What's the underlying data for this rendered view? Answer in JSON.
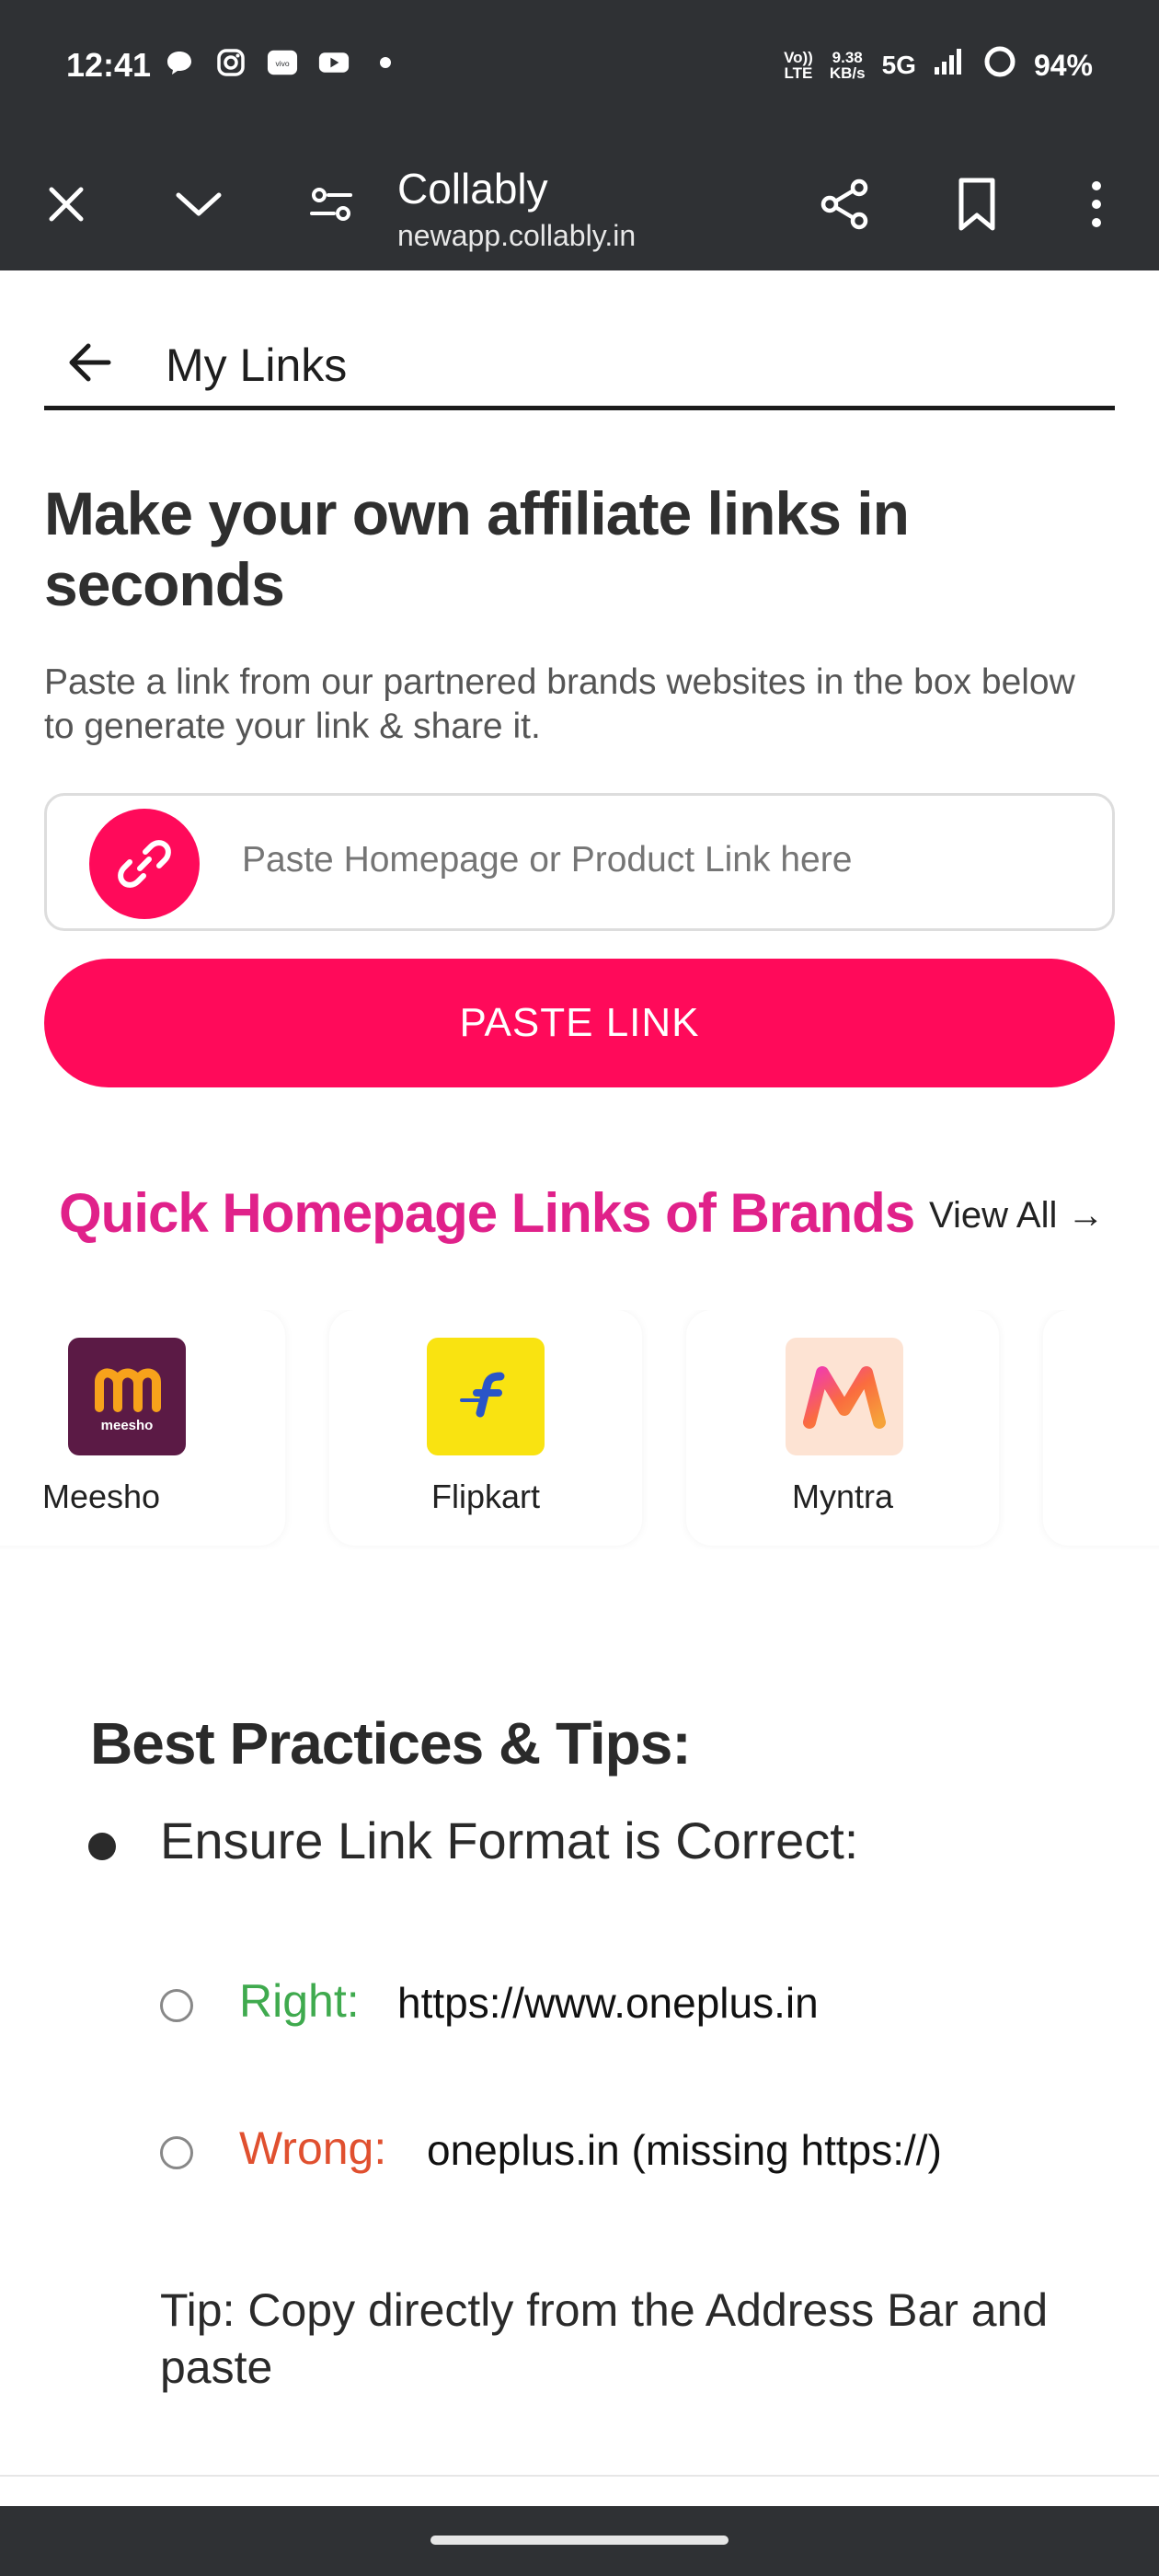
{
  "status_bar": {
    "time": "12:41",
    "network_speed_top": "9.38",
    "network_speed_unit": "KB/s",
    "volte_top": "Vo))",
    "volte_bottom": "LTE",
    "network": "5G",
    "battery": "94%",
    "app_icons": [
      "chat-icon",
      "instagram-icon",
      "vivo-icon",
      "youtube-icon",
      "dot-icon"
    ]
  },
  "browser": {
    "site_name": "Collably",
    "url": "newapp.collably.in"
  },
  "header": {
    "title": "My Links"
  },
  "hero": {
    "headline": "Make your own affiliate links in seconds",
    "subtext": "Paste a link from our partnered brands websites in the box below to generate your link & share it.",
    "input_placeholder": "Paste Homepage or Product Link here",
    "button_label": "PASTE LINK"
  },
  "quick_links": {
    "title": "Quick Homepage Links of Brands",
    "view_all": "View All →",
    "brands": [
      {
        "name": "Meesho",
        "logo_text": "meesho",
        "logo_color": "#5b1a45"
      },
      {
        "name": "Flipkart",
        "logo_color": "#f9e311"
      },
      {
        "name": "Myntra",
        "logo_color": "#fde3d3"
      }
    ]
  },
  "tips": {
    "title": "Best Practices & Tips:",
    "item": "Ensure Link Format is Correct:",
    "right_label": "Right:",
    "right_value": "https://www.oneplus.in",
    "wrong_label": "Wrong:",
    "wrong_value": "oneplus.in (missing https://)",
    "tip": "Tip: Copy directly from the Address Bar and paste"
  },
  "colors": {
    "accent": "#ff0a5a",
    "quick_title": "#e0218a",
    "right": "#3faa4e",
    "wrong": "#e0502f"
  }
}
